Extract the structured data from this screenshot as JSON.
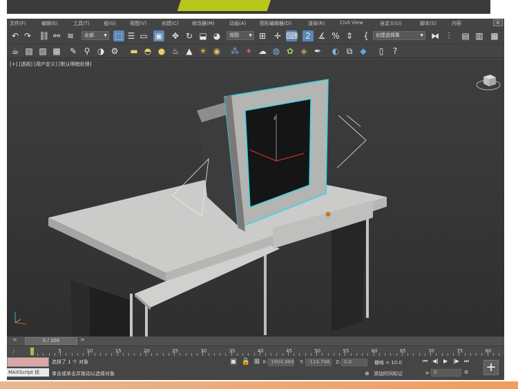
{
  "menu": [
    "文件(F)",
    "编辑(E)",
    "工具(T)",
    "组(G)",
    "视图(V)",
    "创建(C)",
    "修改器(M)",
    "动画(A)",
    "图形编辑器(D)",
    "渲染(R)",
    "Civil View",
    "自定义(U)",
    "脚本(S)",
    "内容"
  ],
  "toolbar": {
    "filter_dropdown": "全部",
    "view_dropdown": "视图",
    "selection_set_dropdown": "创建选择集"
  },
  "viewport": {
    "label": "[+] [透视] [用户定义] [默认明暗处理]",
    "colors": {
      "highlight": "#35d5e8",
      "desk": "#c9c9c7",
      "background": "#363636"
    }
  },
  "timeline": {
    "frame_display": "0 / 100",
    "ruler_labels": [
      "0",
      "5",
      "10",
      "15",
      "20",
      "25",
      "30",
      "35",
      "40",
      "45",
      "50",
      "55",
      "60",
      "65",
      "70",
      "75",
      "80"
    ]
  },
  "status": {
    "maxscript_label": "MAXScript 侦",
    "selection_text": "选择了 1 个 对象",
    "hint_text": "单击或单击并拖动以选择对象",
    "x_label": "X:",
    "x_value": "1904.989",
    "y_label": "Y:",
    "y_value": "-114.786",
    "z_label": "Z:",
    "z_value": "0.0",
    "grid_text": "栅格 = 10.0",
    "add_time_tag": "添加时间标记",
    "frame_value": "0"
  }
}
